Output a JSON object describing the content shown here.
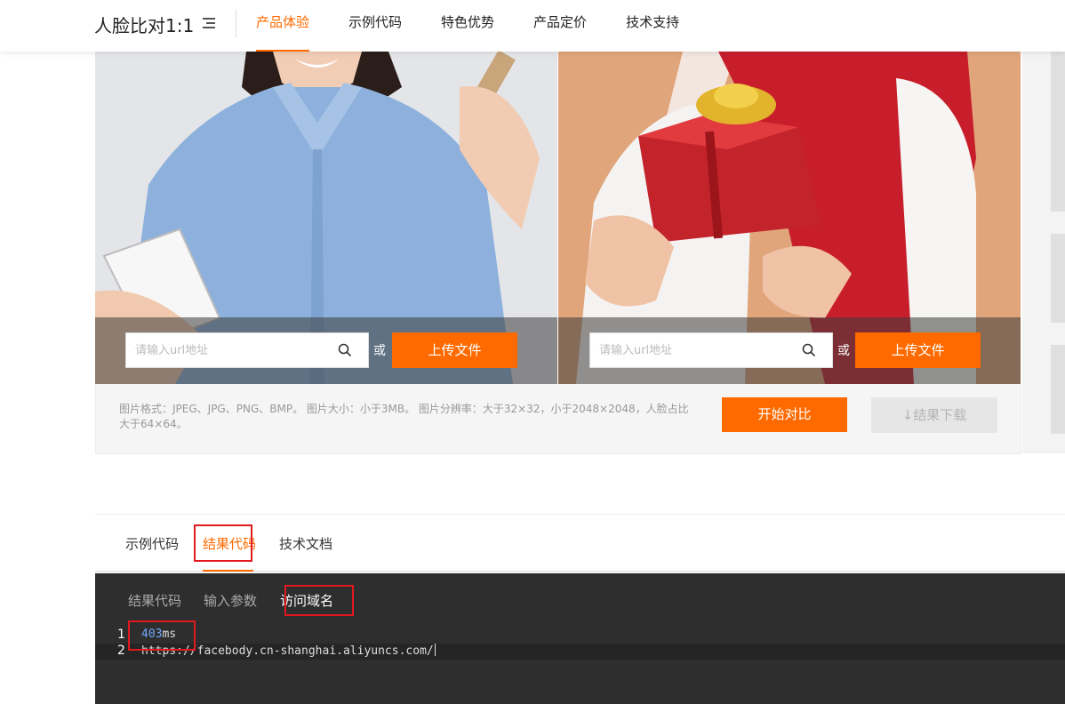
{
  "header": {
    "title": "人脸比对1:1",
    "nav": [
      {
        "label": "产品体验",
        "active": true
      },
      {
        "label": "示例代码",
        "active": false
      },
      {
        "label": "特色优势",
        "active": false
      },
      {
        "label": "产品定价",
        "active": false
      },
      {
        "label": "技术支持",
        "active": false
      }
    ]
  },
  "upload": {
    "left": {
      "placeholder": "请输入url地址",
      "or_label": "或",
      "upload_label": "上传文件"
    },
    "right": {
      "placeholder": "请输入url地址",
      "or_label": "或",
      "upload_label": "上传文件"
    }
  },
  "info": {
    "requirements": "图片格式：JPEG、JPG、PNG、BMP。 图片大小：小于3MB。 图片分辨率：大于32×32，小于2048×2048，人脸占比大于64×64。",
    "start_label": "开始对比",
    "download_label": "↓结果下载"
  },
  "code_tabs": {
    "tabs": [
      {
        "label": "示例代码",
        "active": false
      },
      {
        "label": "结果代码",
        "active": true
      },
      {
        "label": "技术文档",
        "active": false
      }
    ],
    "subtabs": [
      {
        "label": "结果代码",
        "active": false
      },
      {
        "label": "输入参数",
        "active": false
      },
      {
        "label": "访问域名",
        "active": true
      }
    ],
    "lines": [
      {
        "number": "1",
        "value": "403",
        "suffix": "ms"
      },
      {
        "number": "2",
        "text": "https://facebody.cn-shanghai.aliyuncs.com/"
      }
    ]
  },
  "colors": {
    "accent": "#ff6a00",
    "highlight_box": "#e0191f",
    "code_bg": "#2e2e2e"
  }
}
